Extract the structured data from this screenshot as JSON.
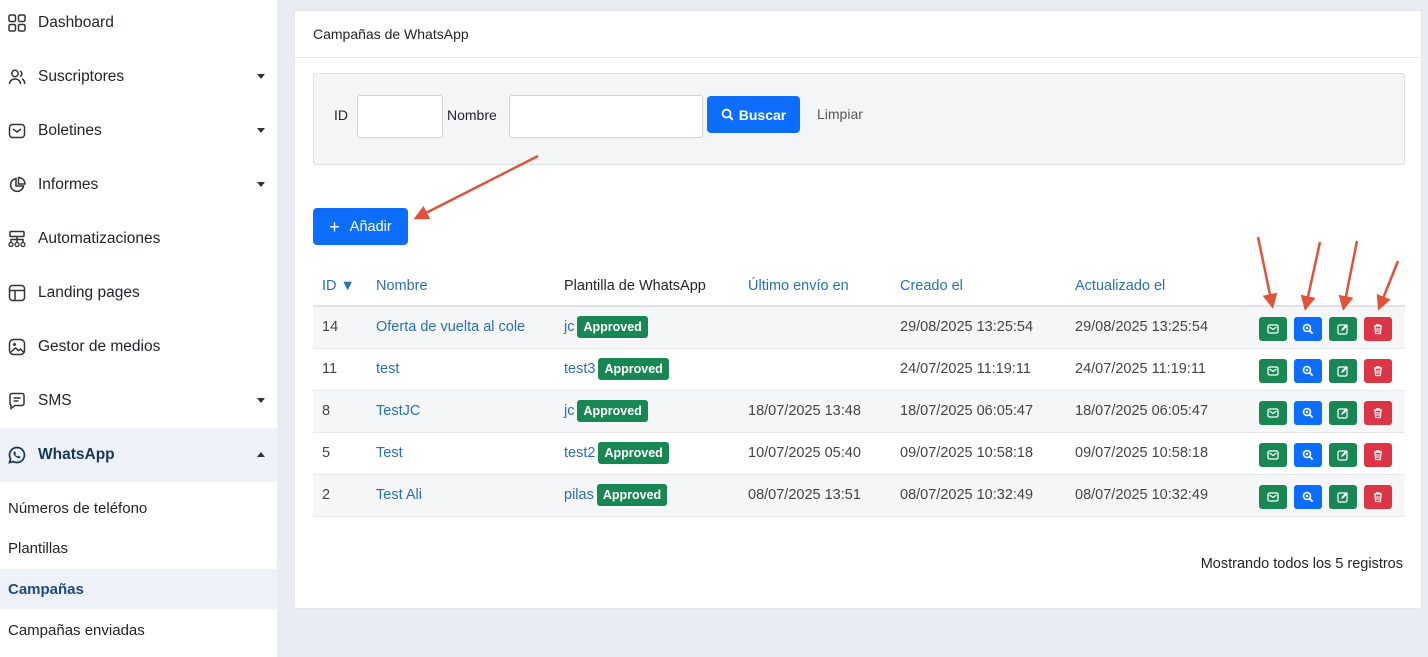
{
  "sidebar": {
    "items": [
      {
        "label": "Dashboard",
        "icon": "dashboard-icon"
      },
      {
        "label": "Suscriptores",
        "icon": "users-icon"
      },
      {
        "label": "Boletines",
        "icon": "mail-icon"
      },
      {
        "label": "Informes",
        "icon": "pie-chart-icon"
      },
      {
        "label": "Automatizaciones",
        "icon": "automation-icon"
      },
      {
        "label": "Landing pages",
        "icon": "layout-icon"
      },
      {
        "label": "Gestor de medios",
        "icon": "media-icon"
      },
      {
        "label": "SMS",
        "icon": "sms-icon"
      },
      {
        "label": "WhatsApp",
        "icon": "whatsapp-icon"
      }
    ],
    "subitems": [
      {
        "label": "Números de teléfono"
      },
      {
        "label": "Plantillas"
      },
      {
        "label": "Campañas"
      },
      {
        "label": "Campañas enviadas"
      }
    ]
  },
  "card": {
    "title": "Campañas de WhatsApp"
  },
  "filter": {
    "id_label": "ID",
    "id_value": "",
    "name_label": "Nombre",
    "name_value": "",
    "search_label": "Buscar",
    "clear_label": "Limpiar"
  },
  "add_label": "Añadir",
  "table": {
    "headers": {
      "id": "ID",
      "name": "Nombre",
      "template": "Plantilla de WhatsApp",
      "last_sent": "Último envío en",
      "created": "Creado el",
      "updated": "Actualizado el"
    },
    "sort_indicator": "▼",
    "rows": [
      {
        "id": "14",
        "name": "Oferta de vuelta al cole",
        "template": "jc",
        "status": "Approved",
        "last_sent": "",
        "created": "29/08/2025 13:25:54",
        "updated": "29/08/2025 13:25:54"
      },
      {
        "id": "11",
        "name": "test",
        "template": "test3",
        "status": "Approved",
        "last_sent": "",
        "created": "24/07/2025 11:19:11",
        "updated": "24/07/2025 11:19:11"
      },
      {
        "id": "8",
        "name": "TestJC",
        "template": "jc",
        "status": "Approved",
        "last_sent": "18/07/2025 13:48",
        "created": "18/07/2025 06:05:47",
        "updated": "18/07/2025 06:05:47"
      },
      {
        "id": "5",
        "name": "Test",
        "template": "test2",
        "status": "Approved",
        "last_sent": "10/07/2025 05:40",
        "created": "09/07/2025 10:58:18",
        "updated": "09/07/2025 10:58:18"
      },
      {
        "id": "2",
        "name": "Test Ali",
        "template": "pilas",
        "status": "Approved",
        "last_sent": "08/07/2025 13:51",
        "created": "08/07/2025 10:32:49",
        "updated": "08/07/2025 10:32:49"
      }
    ],
    "row_actions": [
      "send-icon",
      "preview-icon",
      "edit-icon",
      "delete-icon"
    ]
  },
  "footer": "Mostrando todos los 5 registros",
  "colors": {
    "primary": "#0d6efd",
    "success": "#198754",
    "danger": "#dc3545",
    "link": "#2a6fb5",
    "annotation": "#e2513a"
  }
}
